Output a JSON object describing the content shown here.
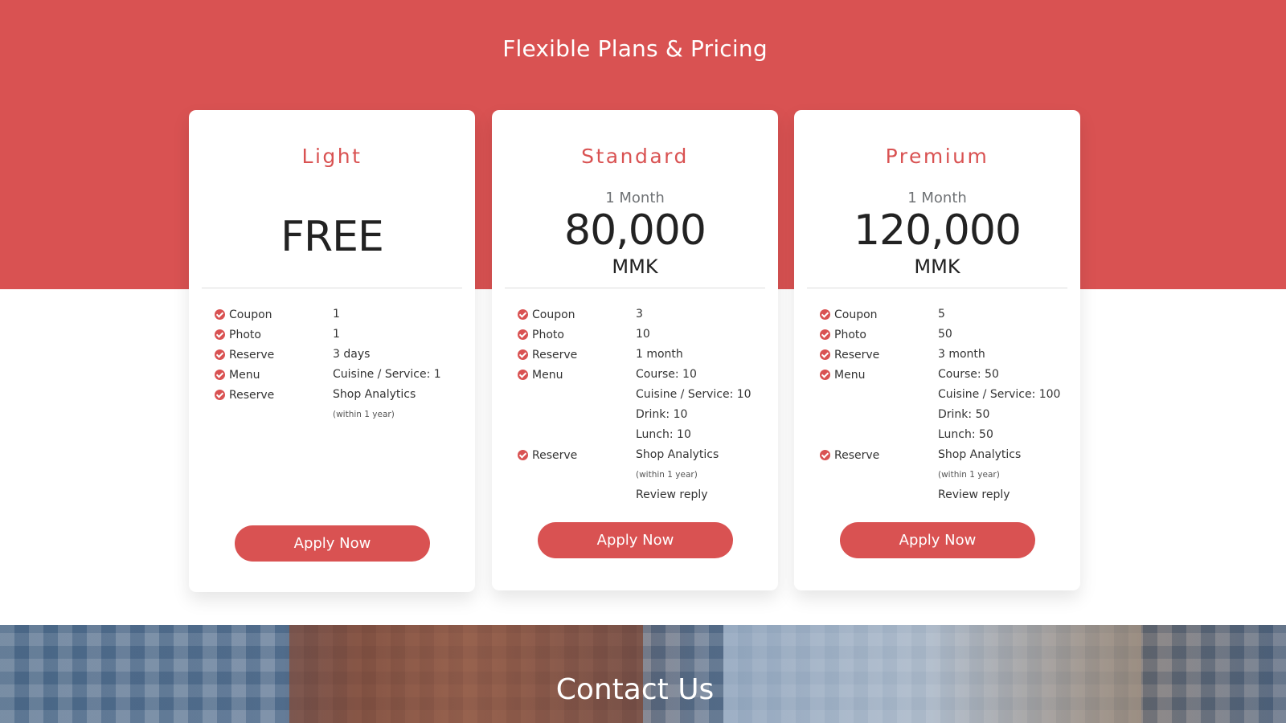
{
  "section": {
    "title": "Flexible Plans & Pricing"
  },
  "colors": {
    "accent": "#d95252",
    "text_dark": "#222222",
    "muted": "#6f7275"
  },
  "plans": [
    {
      "name": "Light",
      "period": "",
      "price": "FREE",
      "currency": "",
      "features": [
        {
          "label": "Coupon",
          "values": [
            "1"
          ]
        },
        {
          "label": "Photo",
          "values": [
            "1"
          ]
        },
        {
          "label": "Reserve",
          "values": [
            "3 days"
          ]
        },
        {
          "label": "Menu",
          "values": [
            "Cuisine / Service: 1"
          ]
        },
        {
          "label": "Reserve",
          "values": [
            "Shop Analytics"
          ],
          "note": "(within 1 year)"
        }
      ],
      "cta": "Apply Now"
    },
    {
      "name": "Standard",
      "period": "1 Month",
      "price": "80,000",
      "currency": "MMK",
      "features": [
        {
          "label": "Coupon",
          "values": [
            "3"
          ]
        },
        {
          "label": "Photo",
          "values": [
            "10"
          ]
        },
        {
          "label": "Reserve",
          "values": [
            "1 month"
          ]
        },
        {
          "label": "Menu",
          "values": [
            "Course: 10",
            "Cuisine / Service: 10",
            "Drink: 10",
            "Lunch: 10"
          ]
        },
        {
          "label": "Reserve",
          "values": [
            "Shop Analytics"
          ],
          "note": "(within 1 year)",
          "extra": "Review reply"
        }
      ],
      "cta": "Apply Now"
    },
    {
      "name": "Premium",
      "period": "1 Month",
      "price": "120,000",
      "currency": "MMK",
      "features": [
        {
          "label": "Coupon",
          "values": [
            "5"
          ]
        },
        {
          "label": "Photo",
          "values": [
            "50"
          ]
        },
        {
          "label": "Reserve",
          "values": [
            "3 month"
          ]
        },
        {
          "label": "Menu",
          "values": [
            "Course: 50",
            "Cuisine / Service: 100",
            "Drink: 50",
            "Lunch: 50"
          ]
        },
        {
          "label": "Reserve",
          "values": [
            "Shop Analytics"
          ],
          "note": "(within 1 year)",
          "extra": "Review reply"
        }
      ],
      "cta": "Apply Now"
    }
  ],
  "contact": {
    "title": "Contact Us"
  },
  "icons": {
    "feature_check": "check-circle-icon"
  }
}
